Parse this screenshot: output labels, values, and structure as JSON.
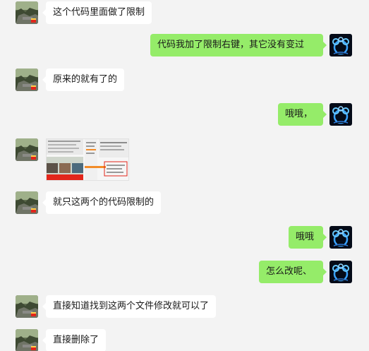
{
  "conversation": {
    "messages": [
      {
        "side": "left",
        "text": "这个代码里面做了限制"
      },
      {
        "side": "right",
        "text": "代码我加了限制右键，其它没有变过"
      },
      {
        "side": "left",
        "text": "原来的就有了的"
      },
      {
        "side": "right",
        "text": "哦哦，"
      },
      {
        "side": "left",
        "type": "image"
      },
      {
        "side": "left",
        "text": "就只这两个的代码限制的"
      },
      {
        "side": "right",
        "text": "哦哦"
      },
      {
        "side": "right",
        "text": "怎么改呢、"
      },
      {
        "side": "left",
        "text": "直接知道找到这两个文件修改就可以了"
      },
      {
        "side": "left",
        "text": "直接删除了"
      }
    ]
  },
  "avatars": {
    "contact": {
      "icon": "landscape-avatar-icon",
      "accent": "#e2261b"
    },
    "self": {
      "icon": "neon-bubble-avatar-icon",
      "accent": "#3aa3ff"
    }
  }
}
